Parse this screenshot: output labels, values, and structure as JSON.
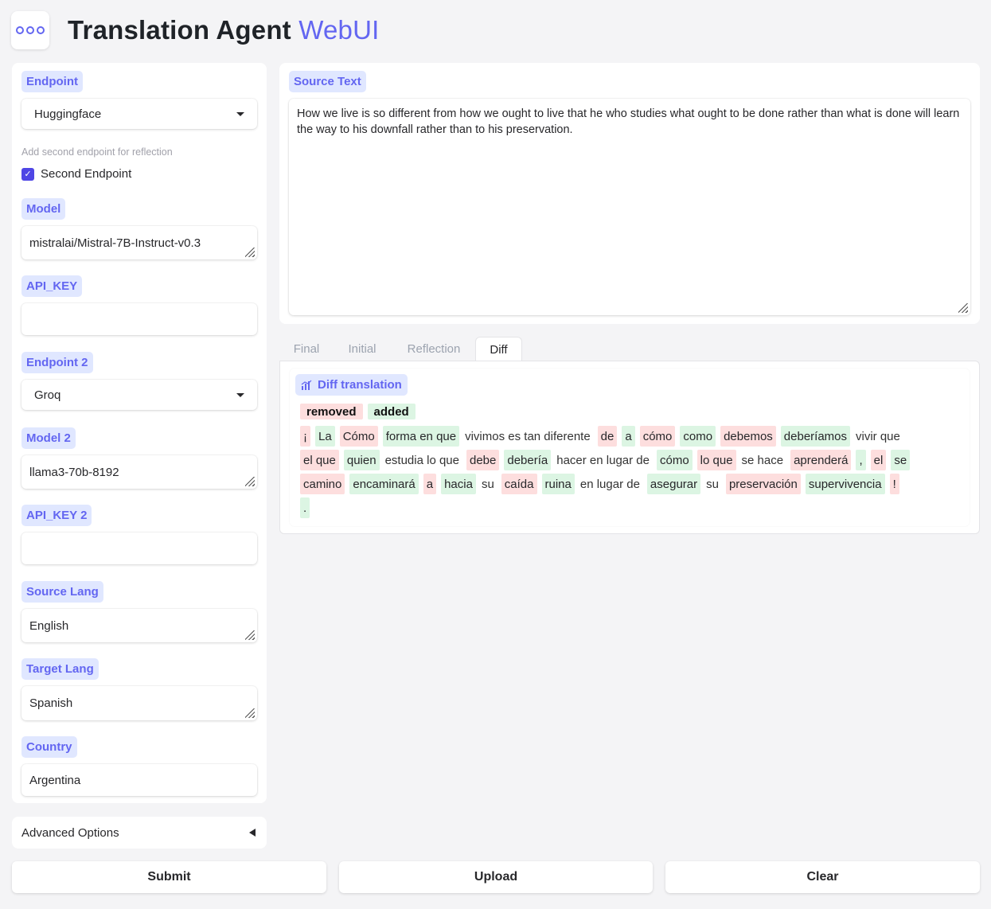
{
  "app": {
    "title_main": "Translation Agent",
    "title_accent": "WebUI"
  },
  "colors": {
    "accent": "#6366f1",
    "chip_bg": "#e0e7ff",
    "removed_bg": "#fddede",
    "added_bg": "#dcf5e3"
  },
  "sidebar": {
    "endpoint_label": "Endpoint",
    "endpoint_value": "Huggingface",
    "second_endpoint_helper": "Add second endpoint for reflection",
    "second_endpoint_checkbox": "Second Endpoint",
    "second_endpoint_checked": true,
    "model_label": "Model",
    "model_value": "mistralai/Mistral-7B-Instruct-v0.3",
    "api_key_label": "API_KEY",
    "api_key_value": "",
    "endpoint2_label": "Endpoint 2",
    "endpoint2_value": "Groq",
    "model2_label": "Model 2",
    "model2_value": "llama3-70b-8192",
    "api_key2_label": "API_KEY 2",
    "api_key2_value": "",
    "source_lang_label": "Source Lang",
    "source_lang_value": "English",
    "target_lang_label": "Target Lang",
    "target_lang_value": "Spanish",
    "country_label": "Country",
    "country_value": "Argentina",
    "advanced_options": "Advanced Options"
  },
  "source": {
    "label": "Source Text",
    "text": "How we live is so different from how we ought to live that he who studies what ought to be done rather than what is done will learn the way to his downfall rather than to his preservation."
  },
  "tabs": [
    "Final",
    "Initial",
    "Reflection",
    "Diff"
  ],
  "active_tab": "Diff",
  "diff": {
    "label": "Diff translation",
    "icon": "diff-chart-icon",
    "legend_removed": "removed",
    "legend_added": "added",
    "lines": [
      [
        {
          "t": "¡",
          "k": "r"
        },
        {
          "t": "La",
          "k": "a"
        },
        {
          "t": "Cómo",
          "k": "r"
        },
        {
          "t": "forma en que",
          "k": "a"
        },
        {
          "t": "vivimos es tan diferente",
          "k": "p"
        },
        {
          "t": "de",
          "k": "r"
        },
        {
          "t": "a",
          "k": "a"
        },
        {
          "t": "cómo",
          "k": "r"
        },
        {
          "t": "como",
          "k": "a"
        },
        {
          "t": "debemos",
          "k": "r"
        },
        {
          "t": "deberíamos",
          "k": "a"
        },
        {
          "t": "vivir que",
          "k": "p"
        }
      ],
      [
        {
          "t": "el que",
          "k": "r"
        },
        {
          "t": "quien",
          "k": "a"
        },
        {
          "t": "estudia lo que",
          "k": "p"
        },
        {
          "t": "debe",
          "k": "r"
        },
        {
          "t": "debería",
          "k": "a"
        },
        {
          "t": "hacer en lugar de",
          "k": "p"
        },
        {
          "t": "cómo",
          "k": "a"
        },
        {
          "t": "lo que",
          "k": "r"
        },
        {
          "t": "se hace",
          "k": "p"
        },
        {
          "t": "aprenderá",
          "k": "r"
        },
        {
          "t": ",",
          "k": "a"
        },
        {
          "t": "el",
          "k": "r"
        },
        {
          "t": "se",
          "k": "a"
        }
      ],
      [
        {
          "t": "camino",
          "k": "r"
        },
        {
          "t": "encaminará",
          "k": "a"
        },
        {
          "t": "a",
          "k": "r"
        },
        {
          "t": "hacia",
          "k": "a"
        },
        {
          "t": "su",
          "k": "p"
        },
        {
          "t": "caída",
          "k": "r"
        },
        {
          "t": "ruina",
          "k": "a"
        },
        {
          "t": "en lugar de",
          "k": "p"
        },
        {
          "t": "asegurar",
          "k": "a"
        },
        {
          "t": "su",
          "k": "p"
        },
        {
          "t": "preservación",
          "k": "r"
        },
        {
          "t": "supervivencia",
          "k": "a"
        },
        {
          "t": "!",
          "k": "r"
        }
      ],
      [
        {
          "t": ".",
          "k": "a"
        }
      ]
    ]
  },
  "buttons": {
    "submit": "Submit",
    "upload": "Upload",
    "clear": "Clear"
  }
}
